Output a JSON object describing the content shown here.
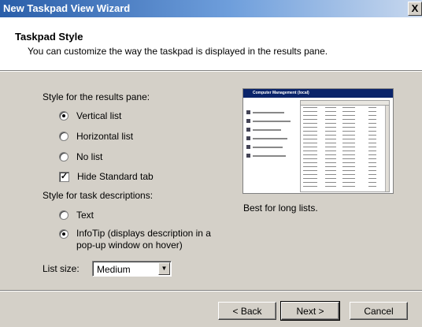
{
  "window": {
    "title": "New Taskpad View Wizard",
    "close_glyph": "X"
  },
  "header": {
    "title": "Taskpad Style",
    "subtitle": "You can customize the way the taskpad is displayed in the results pane."
  },
  "results_pane": {
    "label": "Style for the results pane:",
    "options": [
      {
        "label": "Vertical list",
        "selected": true
      },
      {
        "label": "Horizontal list",
        "selected": false
      },
      {
        "label": "No list",
        "selected": false
      }
    ],
    "hide_standard_tab": {
      "label": "Hide Standard tab",
      "checked": true
    }
  },
  "task_descriptions": {
    "label": "Style for task descriptions:",
    "options": [
      {
        "label": "Text",
        "selected": false
      },
      {
        "label": "InfoTip (displays description in a pop-up window on hover)",
        "selected": true
      }
    ]
  },
  "list_size": {
    "label": "List size:",
    "value": "Medium"
  },
  "preview": {
    "title": "Computer Management (local)",
    "caption": "Best for long lists."
  },
  "buttons": {
    "back": "< Back",
    "next": "Next >",
    "cancel": "Cancel"
  },
  "colors": {
    "titlebar_start": "#2a5ea9",
    "dialog_face": "#d4d0c8",
    "header_bg": "#ffffff"
  }
}
